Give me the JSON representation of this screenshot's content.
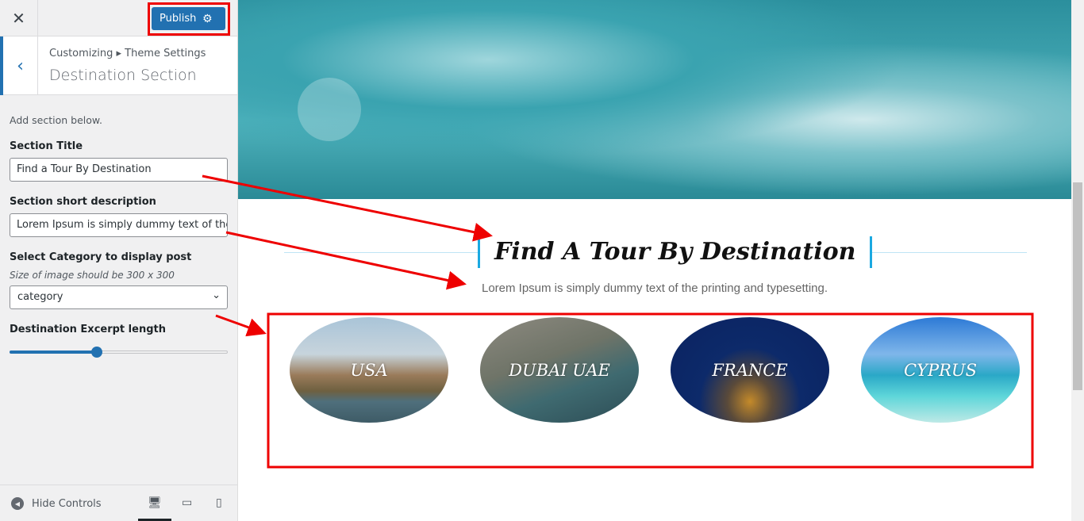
{
  "sidebar": {
    "close_icon": "close-icon",
    "publish_label": "Publish",
    "breadcrumb": "Customizing ▸ Theme Settings",
    "section_title": "Destination Section",
    "note": "Add section below.",
    "fields": {
      "title_label": "Section Title",
      "title_value": "Find a Tour By Destination",
      "desc_label": "Section short description",
      "desc_value": "Lorem Ipsum is simply dummy text of the",
      "cat_label": "Select Category to display post",
      "cat_hint": "Size of image should be 300 x 300",
      "cat_value": "category",
      "excerpt_label": "Destination Excerpt length",
      "excerpt_percent": 40
    },
    "footer": {
      "hide_controls": "Hide Controls",
      "devices": [
        "desktop",
        "tablet",
        "mobile"
      ],
      "active_device": "desktop"
    }
  },
  "preview": {
    "title": "Find A Tour By Destination",
    "description": "Lorem Ipsum is simply dummy text of the printing and typesetting.",
    "destinations": [
      {
        "name": "USA"
      },
      {
        "name": "DUBAI UAE"
      },
      {
        "name": "FRANCE"
      },
      {
        "name": "CYPRUS"
      }
    ],
    "accent": "#1ba9e1"
  },
  "colors": {
    "primary": "#2271b1",
    "annotation": "#ee0000"
  }
}
